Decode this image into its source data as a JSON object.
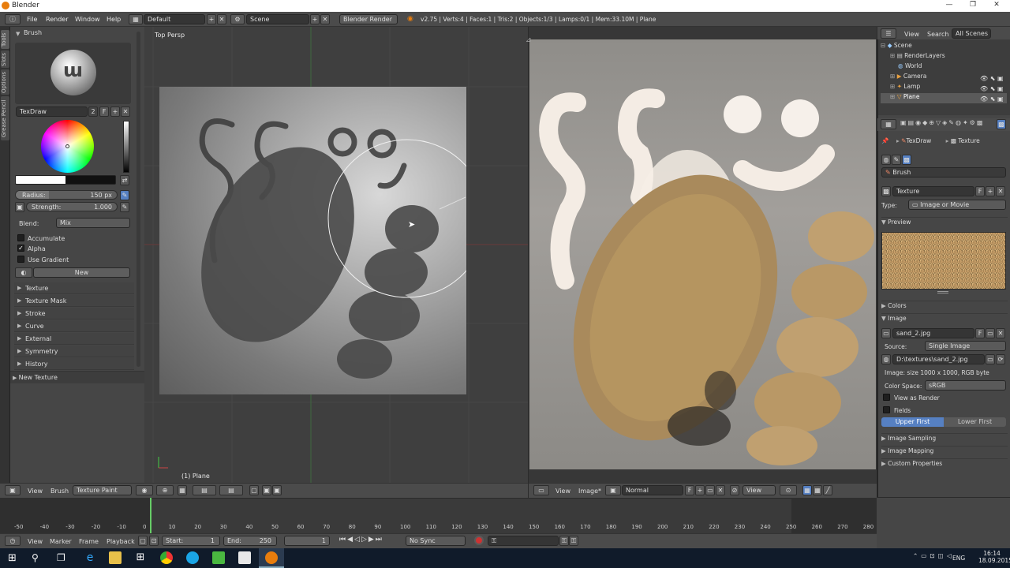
{
  "window": {
    "title": "Blender",
    "minimize": "—",
    "maximize": "❐",
    "close": "✕"
  },
  "topbar": {
    "menus": [
      "File",
      "Render",
      "Window",
      "Help"
    ],
    "layout": "Default",
    "scene": "Scene",
    "engine": "Blender Render",
    "stats": "v2.75 | Verts:4 | Faces:1 | Tris:2 | Objects:1/3 | Lamps:0/1 | Mem:33.10M | Plane"
  },
  "tabs": [
    "Tools",
    "Slots",
    "Options",
    "Grease Pencil"
  ],
  "toolshelf": {
    "brush_header": "Brush",
    "brush_name": "TexDraw",
    "brush_users": "2",
    "brush_fake": "F",
    "radius_label": "Radius:",
    "radius_value": "150 px",
    "strength_label": "Strength:",
    "strength_value": "1.000",
    "blend_label": "Blend:",
    "blend_value": "Mix",
    "accumulate": "Accumulate",
    "alpha": "Alpha",
    "use_gradient": "Use Gradient",
    "new_button": "New",
    "panels": [
      "Texture",
      "Texture Mask",
      "Stroke",
      "Curve",
      "External",
      "Symmetry",
      "History"
    ],
    "new_texture": "New Texture"
  },
  "viewport": {
    "label": "Top Persp",
    "object_label": "(1) Plane",
    "header": {
      "view": "View",
      "brush": "Brush",
      "mode": "Texture Paint"
    }
  },
  "image_editor": {
    "header": {
      "view": "View",
      "image": "Image*",
      "channel": "Normal",
      "fake": "F",
      "view2": "View"
    }
  },
  "outliner": {
    "tabs": [
      "View",
      "Search",
      "All Scenes"
    ],
    "items": [
      "Scene",
      "RenderLayers",
      "World",
      "Camera",
      "Lamp",
      "Plane"
    ]
  },
  "properties": {
    "breadcrumb": [
      "TexDraw",
      "Texture"
    ],
    "brush_label": "Brush",
    "texture_name": "Texture",
    "texture_fake": "F",
    "type_label": "Type:",
    "type_value": "Image or Movie",
    "preview": "Preview",
    "colors": "Colors",
    "image": "Image",
    "image_name": "sand_2.jpg",
    "image_fake": "F",
    "source_label": "Source:",
    "source_value": "Single Image",
    "path": "D:\\textures\\sand_2.jpg",
    "image_info": "Image: size 1000 x 1000, RGB byte",
    "colorspace_label": "Color Space:",
    "colorspace_value": "sRGB",
    "view_as_render": "View as Render",
    "fields": "Fields",
    "upper_first": "Upper First",
    "lower_first": "Lower First",
    "sections": [
      "Image Sampling",
      "Image Mapping",
      "Custom Properties"
    ]
  },
  "timeline": {
    "ticks": [
      "-50",
      "-40",
      "-30",
      "-20",
      "-10",
      "0",
      "10",
      "20",
      "30",
      "40",
      "50",
      "60",
      "70",
      "80",
      "90",
      "100",
      "110",
      "120",
      "130",
      "140",
      "150",
      "160",
      "170",
      "180",
      "190",
      "200",
      "210",
      "220",
      "230",
      "240",
      "250",
      "260",
      "270",
      "280"
    ],
    "view": "View",
    "marker": "Marker",
    "frame": "Frame",
    "playback": "Playback",
    "start_label": "Start:",
    "start_value": "1",
    "end_label": "End:",
    "end_value": "250",
    "current": "1",
    "sync": "No Sync"
  },
  "taskbar": {
    "lang": "ENG",
    "time": "16:14",
    "date": "18.09.2015"
  },
  "colors": {
    "accent": "#e87d0d",
    "selected": "#5680c2"
  }
}
